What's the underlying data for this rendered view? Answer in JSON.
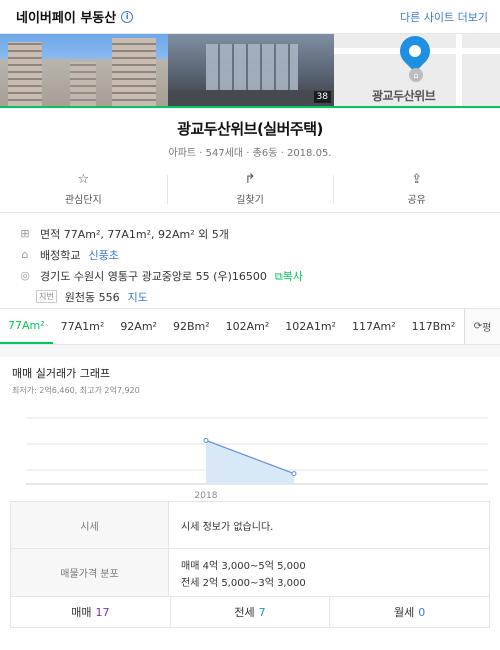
{
  "header": {
    "brand": "네이버페이 부동산",
    "info_icon": "info-icon",
    "more_link": "다른 사이트 더보기"
  },
  "photos": {
    "count": "38",
    "map_label": "광교두산위브"
  },
  "building": {
    "name": "광교두산위브(실버주택)",
    "meta": "아파트 · 547세대 · 총6동 · 2018.05."
  },
  "actions": [
    {
      "icon": "star-icon",
      "label": "관심단지"
    },
    {
      "icon": "directions-icon",
      "label": "길찾기"
    },
    {
      "icon": "share-icon",
      "label": "공유"
    }
  ],
  "info": {
    "area": "면적 77Am², 77A1m², 92Am² 외 5개",
    "school_label": "배정학교",
    "school_name": "신풍초",
    "address": "경기도 수원시 영통구 광교중앙로 55 (우)16500",
    "copy": "복사",
    "jibun_badge": "지번",
    "jibun": "원천동 556",
    "map_link": "지도"
  },
  "tabs": [
    "77Am²",
    "77A1m²",
    "92Am²",
    "92Bm²",
    "102Am²",
    "102A1m²",
    "117Am²",
    "117Bm²"
  ],
  "tab_more": "평",
  "graph": {
    "title": "매매 실거래가 그래프",
    "subtitle": "최저가: 2억6,460, 최고가 2억7,920"
  },
  "chart_data": {
    "type": "line",
    "x": [
      "2018"
    ],
    "series": [
      {
        "values": [
          27920,
          26460
        ]
      }
    ],
    "xlabel": "2018"
  },
  "table": {
    "market_head": "시세",
    "market_value": "시세 정보가 없습니다.",
    "dist_head": "매물가격 분포",
    "sale_line": "매매 4억 3,000~5억 5,000",
    "rent_line": "전세 2억 5,000~3억 3,000"
  },
  "counts": [
    {
      "label": "매매",
      "value": "17"
    },
    {
      "label": "전세",
      "value": "7"
    },
    {
      "label": "월세",
      "value": "0"
    }
  ],
  "colors": {
    "accent": "#03c75a",
    "link": "#3b78d8"
  }
}
